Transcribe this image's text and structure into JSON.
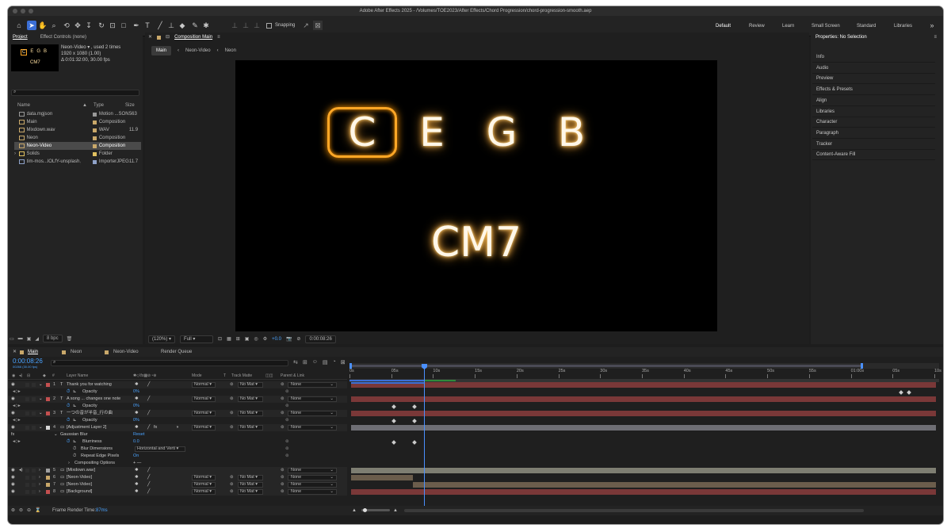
{
  "window": {
    "title": "Adobe After Effects 2025 - /Volumes/TOE2023/After Effects/Chord Progression/chord-progression-smooth.aep"
  },
  "toolbar": {
    "snapping_label": "Snapping",
    "workspaces": [
      "Default",
      "Review",
      "Learn",
      "Small Screen",
      "Standard",
      "Libraries"
    ]
  },
  "project": {
    "tabs": [
      "Project",
      "Effect Controls (none)"
    ],
    "selected": {
      "name": "Neon-Video ▾ , used 2 times",
      "dims": "1920 x 1080 (1.00)",
      "duration": "Δ 0:01:32:00, 30.00 fps"
    },
    "thumb": {
      "notes": [
        "C",
        "E",
        "G",
        "B"
      ],
      "chord": "CM7"
    },
    "columns": [
      "Name",
      "Type",
      "Size"
    ],
    "items": [
      {
        "name": "data.mgjson",
        "type": "Motion ...SON",
        "size": "563",
        "color": "#999999"
      },
      {
        "name": "Main",
        "type": "Composition",
        "size": "",
        "color": "#c9a86a"
      },
      {
        "name": "Mixdown.wav",
        "type": "WAV",
        "size": "11.9",
        "color": "#c9a86a"
      },
      {
        "name": "Neon",
        "type": "Composition",
        "size": "",
        "color": "#c9a86a"
      },
      {
        "name": "Neon-Video",
        "type": "Composition",
        "size": "",
        "color": "#c9a86a"
      },
      {
        "name": "Solids",
        "type": "Folder",
        "size": "",
        "color": "#e0c060"
      },
      {
        "name": "tim-mos...lOLfY-unsplash.jpg",
        "type": "ImporterJPEG",
        "size": "11.7",
        "color": "#8fa2c8"
      }
    ],
    "bpc": "8 bpc"
  },
  "composition": {
    "tab": "Composition Main",
    "breadcrumbs": [
      "Main",
      "Neon-Video",
      "Neon"
    ],
    "notes": [
      "C",
      "E",
      "G",
      "B"
    ],
    "chord": "CM7",
    "zoom": "(120%)",
    "resolution": "Full",
    "exposure": "+0.0",
    "timecode": "0:00:08:26"
  },
  "properties": {
    "title": "Properties: No Selection",
    "items": [
      "Info",
      "Audio",
      "Preview",
      "Effects & Presets",
      "Align",
      "Libraries",
      "Character",
      "Paragraph",
      "Tracker",
      "Content-Aware Fill"
    ]
  },
  "timeline": {
    "tabs": [
      "Main",
      "Neon",
      "Neon-Video",
      "Render Queue"
    ],
    "timecode": "0:00:08:26",
    "subcode": "00266 (30.00 fps)",
    "columns": {
      "num": "#",
      "layer": "Layer Name",
      "mode": "Mode",
      "t": "T",
      "trackmatte": "Track Matte",
      "parent": "Parent & Link"
    },
    "ruler": [
      "0s",
      "05s",
      "10s",
      "15s",
      "20s",
      "25s",
      "30s",
      "35s",
      "40s",
      "45s",
      "50s",
      "55s",
      "01:00s",
      "05s",
      "10s"
    ],
    "rows": [
      {
        "num": "1",
        "name": "Thank you for watching",
        "mode": "Normal",
        "tm": "No Mat",
        "parent": "None",
        "color": "#c45050",
        "bar": "#7a3838",
        "type": "T"
      },
      {
        "prop": "Opacity",
        "value": "0%"
      },
      {
        "num": "2",
        "name": "A song ... changes one note",
        "mode": "Normal",
        "tm": "No Mat",
        "parent": "None",
        "color": "#c45050",
        "bar": "#7a3838",
        "type": "T"
      },
      {
        "prop": "Opacity",
        "value": "0%"
      },
      {
        "num": "3",
        "name": "一つの音が半音_行の曲",
        "mode": "Normal",
        "tm": "No Mat",
        "parent": "None",
        "color": "#c45050",
        "bar": "#7a3838",
        "type": "T"
      },
      {
        "prop": "Opacity",
        "value": "0%"
      },
      {
        "num": "4",
        "name": "[Adjustment Layer 2]",
        "mode": "Normal",
        "tm": "No Mat",
        "parent": "None",
        "color": "#d8d8d8",
        "bar": "#6e6e74",
        "type": "adj"
      },
      {
        "effect": "Gaussian Blur",
        "value": "Reset"
      },
      {
        "prop": "Blurriness",
        "value": "0.0"
      },
      {
        "prop": "Blur Dimensions",
        "value": "Horizontal and Verti"
      },
      {
        "prop": "Repeat Edge Pixels",
        "value": "On"
      },
      {
        "prop": "Compositing Options",
        "value": "+ —"
      },
      {
        "num": "5",
        "name": "[Mixdown.wav]",
        "mode": "",
        "tm": "",
        "parent": "None",
        "color": "#a0a0a0",
        "bar": "#7e7e72",
        "type": "audio"
      },
      {
        "num": "6",
        "name": "[Neon-Video]",
        "mode": "Normal",
        "tm": "No Mat",
        "parent": "None",
        "color": "#c9a86a",
        "bar": "#6b5d4c",
        "type": "comp"
      },
      {
        "num": "7",
        "name": "[Neon-Video]",
        "mode": "Normal",
        "tm": "No Mat",
        "parent": "None",
        "color": "#c9a86a",
        "bar": "#6b5d4c",
        "type": "comp"
      },
      {
        "num": "8",
        "name": "[Background]",
        "mode": "Normal",
        "tm": "No Mat",
        "parent": "None",
        "color": "#c45050",
        "bar": "#7a3838",
        "type": "solid"
      }
    ],
    "footer": {
      "render_label": "Frame Render Time:",
      "render_time": "87ms"
    }
  },
  "colors": {
    "accent": "#3b6fd6",
    "playhead": "#4a90ff",
    "glow": "#ffa726"
  }
}
